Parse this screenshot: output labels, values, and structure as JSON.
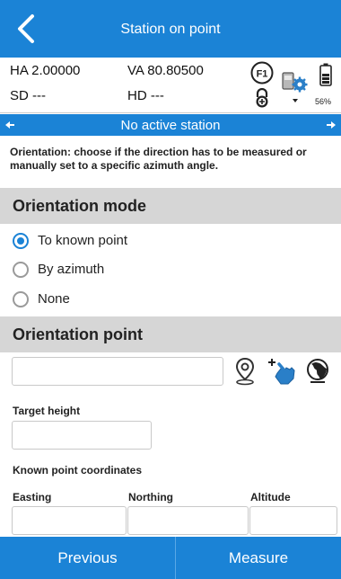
{
  "header": {
    "title": "Station on point"
  },
  "status": {
    "ha": "HA 2.00000",
    "va": "VA 80.80500",
    "sd": "SD ---",
    "hd": "HD ---",
    "f1_label": "F1",
    "battery_percent": "56%"
  },
  "station_bar": {
    "text": "No active station"
  },
  "description": "Orientation: choose if the direction has to be measured or manually set to a specific azimuth angle.",
  "orientation_mode": {
    "title": "Orientation mode",
    "options": [
      {
        "label": "To known point",
        "selected": true
      },
      {
        "label": "By azimuth",
        "selected": false
      },
      {
        "label": "None",
        "selected": false
      }
    ]
  },
  "orientation_point": {
    "title": "Orientation point",
    "point_value": "",
    "target_height_label": "Target height",
    "target_height_value": "",
    "known_coords_label": "Known point coordinates",
    "easting_label": "Easting",
    "northing_label": "Northing",
    "altitude_label": "Altitude",
    "easting_value": "",
    "northing_value": "",
    "altitude_value": ""
  },
  "footer": {
    "previous_label": "Previous",
    "measure_label": "Measure"
  },
  "colors": {
    "accent": "#1b83d6",
    "section_bg": "#d6d6d6"
  }
}
